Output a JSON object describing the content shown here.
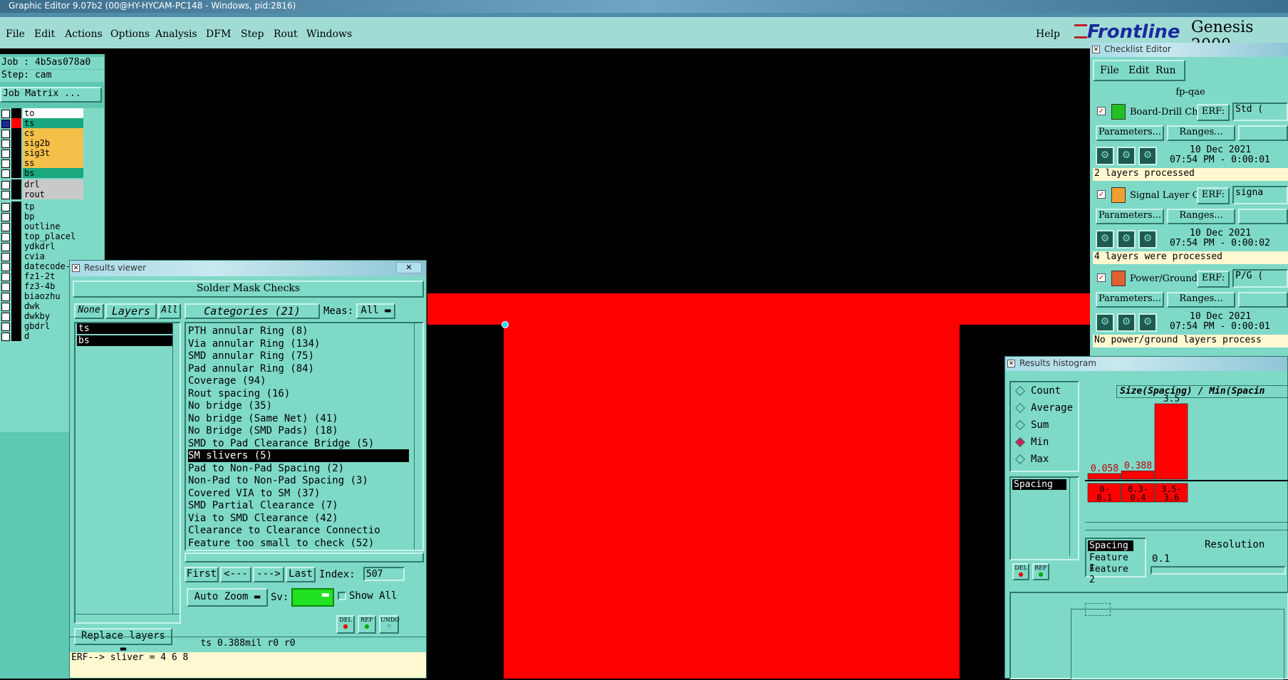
{
  "window": {
    "title": "Graphic Editor 9.07b2 (00@HY-HYCAM-PC148 - Windows, pid:2816)"
  },
  "menu": [
    "File",
    "Edit",
    "Actions",
    "Options",
    "Analysis",
    "DFM",
    "Step",
    "Rout",
    "Windows"
  ],
  "help": "Help",
  "brand": {
    "logo": "Frontline",
    "product": "Genesis 2000"
  },
  "job": {
    "job": "Job : 4b5as078a0",
    "step": "Step: cam",
    "matrix_btn": "Job Matrix ..."
  },
  "layers": [
    {
      "name": "to",
      "swatch": "#000",
      "bg": "#fff"
    },
    {
      "name": "ts",
      "swatch": "#ff0000",
      "bg": "#1aa77e",
      "checked_blue": true
    },
    {
      "name": "cs",
      "swatch": "#000",
      "bg": "#f4c04a"
    },
    {
      "name": "sig2b",
      "swatch": "#000",
      "bg": "#f4c04a"
    },
    {
      "name": "sig3t",
      "swatch": "#000",
      "bg": "#f4c04a"
    },
    {
      "name": "ss",
      "swatch": "#000",
      "bg": "#f4c04a"
    },
    {
      "name": "bs",
      "swatch": "#000",
      "bg": "#1aa77e"
    },
    {
      "name": "drl",
      "swatch": "#000",
      "bg": "#c9c9c9"
    },
    {
      "name": "rout",
      "swatch": "#000",
      "bg": "#c9c9c9"
    },
    {
      "name": "tp",
      "swatch": "#000",
      "bg": "#7fd9c7"
    },
    {
      "name": "bp",
      "swatch": "#000",
      "bg": "#7fd9c7"
    },
    {
      "name": "outline",
      "swatch": "#000",
      "bg": "#7fd9c7"
    },
    {
      "name": "top_placel",
      "swatch": "#000",
      "bg": "#7fd9c7"
    },
    {
      "name": "ydkdrl",
      "swatch": "#000",
      "bg": "#7fd9c7"
    },
    {
      "name": "cvia",
      "swatch": "#000",
      "bg": "#7fd9c7"
    },
    {
      "name": "datecode-",
      "swatch": "#000",
      "bg": "#7fd9c7"
    },
    {
      "name": "fz1-2t",
      "swatch": "#000",
      "bg": "#7fd9c7"
    },
    {
      "name": "fz3-4b",
      "swatch": "#000",
      "bg": "#7fd9c7"
    },
    {
      "name": "biaozhu",
      "swatch": "#000",
      "bg": "#7fd9c7"
    },
    {
      "name": "dwk",
      "swatch": "#000",
      "bg": "#7fd9c7"
    },
    {
      "name": "dwkby",
      "swatch": "#000",
      "bg": "#7fd9c7"
    },
    {
      "name": "gbdrl",
      "swatch": "#000",
      "bg": "#7fd9c7"
    },
    {
      "name": "d",
      "swatch": "#000",
      "bg": "#7fd9c7"
    }
  ],
  "results_viewer": {
    "title": "Results viewer",
    "header": "Solder Mask Checks",
    "none": "None",
    "layers": "Layers",
    "all": "All",
    "categories": "Categories (21)",
    "meas_label": "Meas:",
    "meas_value": "All",
    "layer_items": [
      "ts",
      "bs"
    ],
    "category_items": [
      "PTH annular Ring (8)",
      "Via annular Ring (134)",
      "SMD annular Ring (75)",
      "Pad annular Ring (84)",
      "Coverage (94)",
      "Rout spacing (16)",
      "No bridge (35)",
      "No bridge (Same Net) (41)",
      "No Bridge (SMD Pads) (18)",
      "SMD to Pad Clearance Bridge (5)",
      "SM slivers (5)",
      "Pad to Non-Pad Spacing (2)",
      "Non-Pad to Non-Pad Spacing (3)",
      "Covered VIA to SM (37)",
      "SMD Partial Clearance (7)",
      "Via to SMD Clearance (42)",
      "Clearance to Clearance Connectio",
      "Feature too small to check (52)"
    ],
    "selected_category_index": 10,
    "first": "First",
    "prev": "<---",
    "next": "--->",
    "last": "Last",
    "index_label": "Index:",
    "index_value": "507",
    "auto_zoom": "Auto Zoom",
    "sv_label": "Sv:",
    "show_all": "Show All",
    "replace_layers": "Replace layers",
    "del": "DEL",
    "ref": "REF",
    "undo": "UNDO",
    "status": "ts 0.388mil  r0  r0",
    "erf_line": "ERF--> sliver = 4 6 8"
  },
  "checklist": {
    "title": "Checklist Editor",
    "menu": [
      "File",
      "Edit",
      "Run"
    ],
    "name": "fp-qae",
    "checks": [
      {
        "label": "Board-Drill Che",
        "erf": "ERF:",
        "erf_value": "Std (",
        "date": "10 Dec 2021",
        "time": "07:54 PM - 0:00:01",
        "status": "2 layers processed",
        "icon_color": "#22c022"
      },
      {
        "label": "Signal Layer Ch",
        "erf": "ERF:",
        "erf_value": "signa",
        "date": "10 Dec 2021",
        "time": "07:54 PM - 0:00:02",
        "status": "4 layers were processed",
        "icon_color": "#f0a030"
      },
      {
        "label": "Power/Ground C",
        "erf": "ERF:",
        "erf_value": "P/G (",
        "date": "10 Dec 2021",
        "time": "07:54 PM - 0:00:01",
        "status": "No power/ground layers process",
        "icon_color": "#e06030"
      }
    ],
    "params": "Parameters...",
    "ranges": "Ranges..."
  },
  "histogram": {
    "title": "Results histogram",
    "modes": [
      "Count",
      "Average",
      "Sum",
      "Min",
      "Max"
    ],
    "selected_mode": "Min",
    "list_item": "Spacing",
    "chart_title": "Size(Spacing) / Min(Spacin",
    "bars": [
      {
        "label": "0.058",
        "range": "0-\n0.1",
        "value": 0.058
      },
      {
        "label": "0.388",
        "range": "0.3-\n0.4",
        "value": 0.388
      },
      {
        "label": "3.5",
        "range": "3.5-\n3.6",
        "value": 3.5
      }
    ],
    "feature_list": [
      "Spacing",
      "Feature 1",
      "Feature 2"
    ],
    "resolution_label": "Resolution",
    "resolution_value": "0.1",
    "del": "DEL",
    "ref": "REF"
  }
}
